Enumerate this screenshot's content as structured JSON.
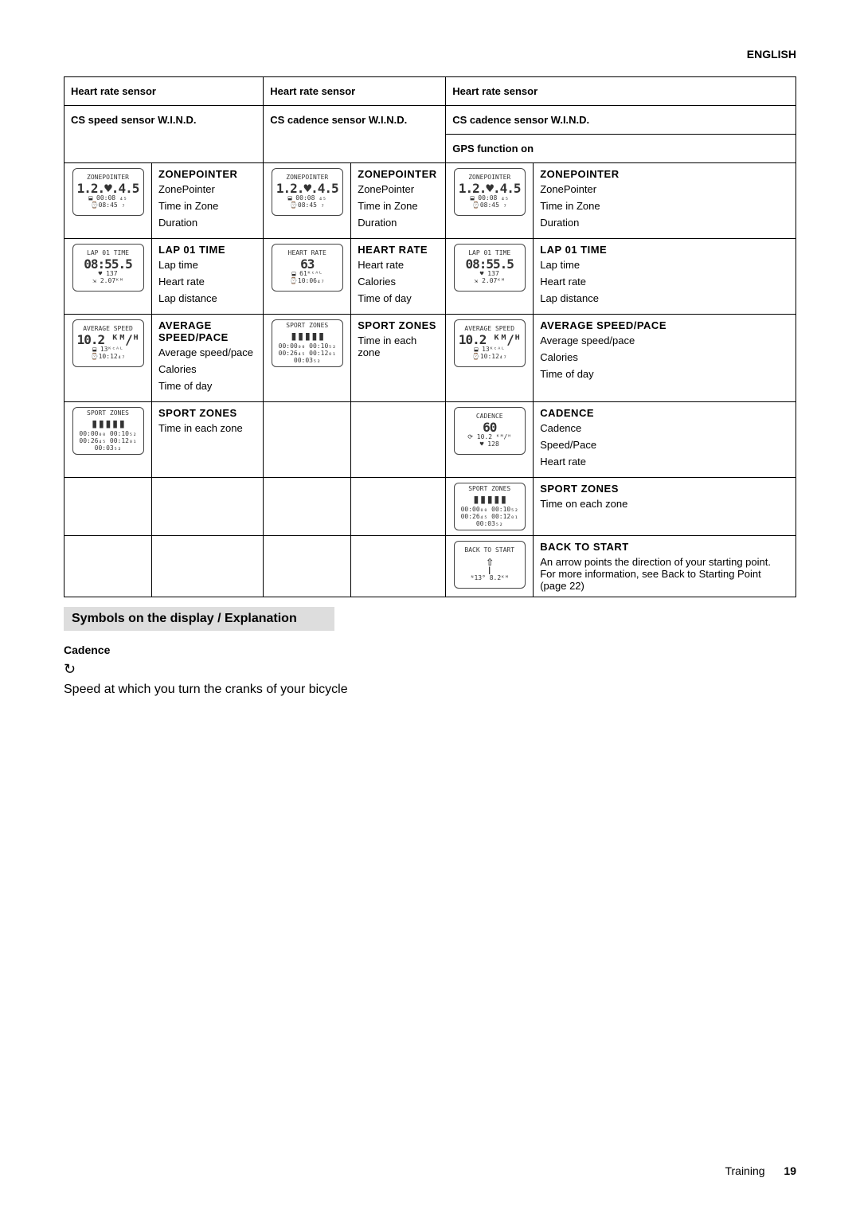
{
  "lang": "ENGLISH",
  "col1": {
    "h1": "Heart rate sensor",
    "h2": "CS speed sensor W.I.N.D."
  },
  "col2": {
    "h1": "Heart rate sensor",
    "h2": "CS cadence sensor W.I.N.D."
  },
  "col3": {
    "h1": "Heart rate sensor",
    "h2": "CS cadence sensor W.I.N.D.",
    "h3": "GPS function on"
  },
  "rows": {
    "zp": {
      "title": "ZONEPOINTER",
      "items": [
        "ZonePointer",
        "Time in Zone",
        "Duration"
      ],
      "icon": {
        "top": "ZONEPOINTER",
        "big": "1.2.♥.4.5",
        "mid": "⬓ 00:08 ₄₅",
        "bot": "⌚08:45 ₇ "
      }
    },
    "lap": {
      "title": "LAP 01 TIME",
      "items": [
        "Lap time",
        "Heart rate",
        "Lap distance"
      ],
      "icon": {
        "top": "LAP 01 TIME",
        "big": "08:55.5",
        "mid": "♥ 137",
        "bot": "⇲ 2.07ᴷᴹ"
      }
    },
    "hr": {
      "title": "HEART RATE",
      "items": [
        "Heart rate",
        "Calories",
        "Time of day"
      ],
      "icon": {
        "top": "HEART RATE",
        "big": "63",
        "mid": "⬓ 61ᴷᶜᴬᴸ",
        "bot": "⌚10:06₄₇"
      }
    },
    "avg": {
      "title": "AVERAGE SPEED/PACE",
      "items": [
        "Average speed/pace",
        "Calories",
        "Time of day"
      ],
      "icon": {
        "top": "AVERAGE SPEED",
        "big": "10.2 ᴷᴹ/ᴴ",
        "mid": "⬓ 13ᴷᶜᴬᴸ",
        "bot": "⌚10:12₄₇"
      }
    },
    "sz": {
      "title": "SPORT ZONES",
      "items": [
        "Time in each zone"
      ],
      "icon": {
        "top": "SPORT ZONES",
        "big": "▮▮▮▮▮",
        "mid": "00:00₀₀ 00:10₅₂",
        "bot": "00:26₄₅ 00:12₀₁ 00:03₅₂"
      }
    },
    "cad": {
      "title": "CADENCE",
      "items": [
        "Cadence",
        "Speed/Pace",
        "Heart rate"
      ],
      "icon": {
        "top": "CADENCE",
        "big": "60",
        "mid": "⟳ 10.2 ᴷᴹ/ᴴ",
        "bot": "♥ 128"
      }
    },
    "sz2": {
      "title": "SPORT ZONES",
      "items": [
        "Time on each zone"
      ],
      "icon": {
        "top": "SPORT ZONES",
        "big": "▮▮▮▮▮",
        "mid": "00:00₀₀ 00:10₅₂",
        "bot": "00:26₄₅ 00:12₀₁ 00:03₅₂"
      }
    },
    "back": {
      "title": "BACK TO START",
      "desc": "An arrow points the direction of your starting point. For more information, see Back to Starting Point (page 22)",
      "icon": {
        "top": "BACK TO START",
        "big": "⇧",
        "mid": "┃",
        "bot": "ᴺ13°   8.2ᴷᴹ"
      }
    }
  },
  "symbols": "Symbols on the display / Explanation",
  "cadence": {
    "title": "Cadence",
    "desc": "Speed at which you turn the cranks of your bicycle"
  },
  "footer": {
    "label": "Training",
    "page": "19"
  }
}
